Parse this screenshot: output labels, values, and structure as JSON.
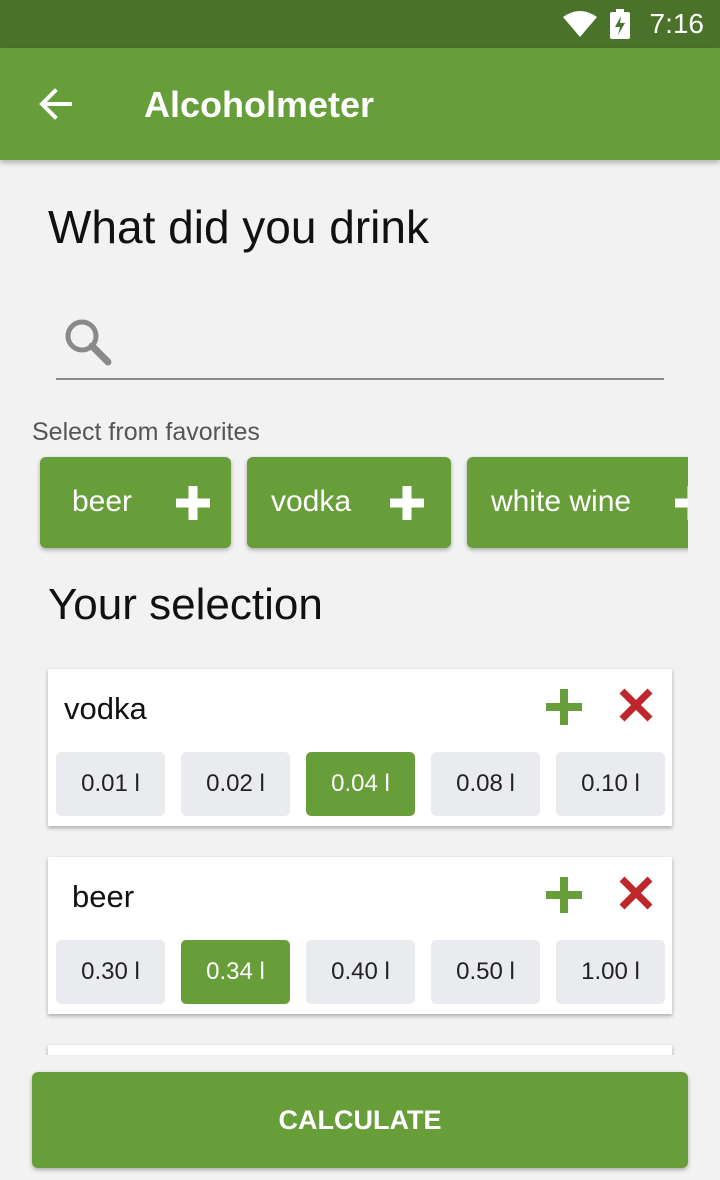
{
  "status": {
    "time": "7:16"
  },
  "app": {
    "title": "Alcoholmeter"
  },
  "heading": "What did you drink",
  "search": {
    "placeholder": ""
  },
  "favorites": {
    "label": "Select from favorites",
    "items": [
      "beer",
      "vodka",
      "white wine"
    ]
  },
  "selection": {
    "heading": "Your selection",
    "items": [
      {
        "name": "vodka",
        "sizes": [
          "0.01 l",
          "0.02 l",
          "0.04 l",
          "0.08 l",
          "0.10 l"
        ],
        "selected": "0.04 l"
      },
      {
        "name": "beer",
        "sizes": [
          "0.30 l",
          "0.34 l",
          "0.40 l",
          "0.50 l",
          "1.00 l"
        ],
        "selected": "0.34 l"
      }
    ]
  },
  "actions": {
    "calculate": "CALCULATE"
  },
  "colors": {
    "primary": "#679e39",
    "status_bar": "#4b722a",
    "remove": "#c0272d",
    "size_bg": "#e9ebee"
  },
  "icons": {
    "back": "arrow-left-icon",
    "search": "search-icon",
    "add": "plus-icon",
    "remove": "x-icon"
  }
}
